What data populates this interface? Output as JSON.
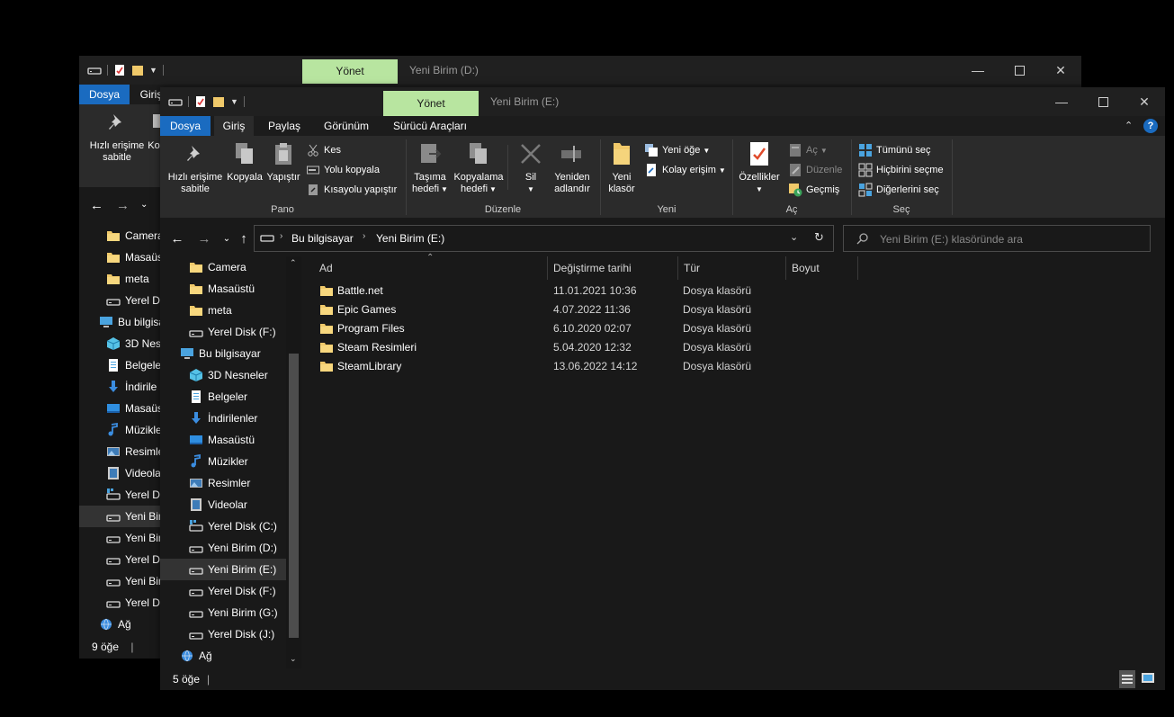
{
  "back_window": {
    "manage_tab": "Yönet",
    "title": "Yeni Birim (D:)",
    "tab_file": "Dosya",
    "tab_home": "Giriş",
    "pin_label": "Hızlı erişime sabitle",
    "copy_short": "Ko",
    "nav_items": [
      {
        "label": "Camera",
        "icon": "folder-icon"
      },
      {
        "label": "Masaüstü",
        "icon": "folder-icon"
      },
      {
        "label": "meta",
        "icon": "folder-icon"
      },
      {
        "label": "Yerel D",
        "icon": "drive-icon"
      },
      {
        "label": "Bu bilgisa",
        "icon": "pc-icon"
      },
      {
        "label": "3D Nesne",
        "icon": "cube-icon"
      },
      {
        "label": "Belgeler",
        "icon": "document-icon"
      },
      {
        "label": "İndirile",
        "icon": "download-icon"
      },
      {
        "label": "Masaüs",
        "icon": "desktop-icon"
      },
      {
        "label": "Müzikle",
        "icon": "music-icon"
      },
      {
        "label": "Resimle",
        "icon": "pictures-icon"
      },
      {
        "label": "Videola",
        "icon": "video-icon"
      },
      {
        "label": "Yerel D",
        "icon": "system-drive-icon"
      },
      {
        "label": "Yeni Bir",
        "icon": "drive-icon"
      },
      {
        "label": "Yeni Bir",
        "icon": "drive-icon"
      },
      {
        "label": "Yerel D",
        "icon": "drive-icon"
      },
      {
        "label": "Yeni Bir",
        "icon": "drive-icon"
      },
      {
        "label": "Yerel D",
        "icon": "drive-icon"
      },
      {
        "label": "Ağ",
        "icon": "network-icon"
      }
    ],
    "status": "9 öğe"
  },
  "window": {
    "manage_tab": "Yönet",
    "title": "Yeni Birim (E:)"
  },
  "tabs": [
    "Dosya",
    "Giriş",
    "Paylaş",
    "Görünüm",
    "Sürücü Araçları"
  ],
  "ribbon": {
    "pano": {
      "group": "Pano",
      "pin": "Hızlı erişime sabitle",
      "copy": "Kopyala",
      "paste": "Yapıştır",
      "cut": "Kes",
      "copy_path": "Yolu kopyala",
      "paste_shortcut": "Kısayolu yapıştır"
    },
    "duzenle": {
      "group": "Düzenle",
      "move_to_line1": "Taşıma",
      "move_to_line2": "hedefi",
      "copy_to_line1": "Kopyalama",
      "copy_to_line2": "hedefi",
      "delete": "Sil",
      "rename_line1": "Yeniden",
      "rename_line2": "adlandır"
    },
    "yeni": {
      "group": "Yeni",
      "new_folder_line1": "Yeni",
      "new_folder_line2": "klasör",
      "new_item": "Yeni öğe",
      "easy_access": "Kolay erişim"
    },
    "ac": {
      "group": "Aç",
      "properties": "Özellikler",
      "open": "Aç",
      "edit": "Düzenle",
      "history": "Geçmiş"
    },
    "sec": {
      "group": "Seç",
      "select_all": "Tümünü seç",
      "select_none": "Hiçbirini seçme",
      "invert": "Diğerlerini seç"
    }
  },
  "address": {
    "crumb1": "Bu bilgisayar",
    "crumb2": "Yeni Birim (E:)"
  },
  "search": {
    "placeholder": "Yeni Birim (E:) klasöründe ara"
  },
  "nav_items": [
    {
      "label": "Camera",
      "icon": "folder-icon"
    },
    {
      "label": "Masaüstü",
      "icon": "folder-icon"
    },
    {
      "label": "meta",
      "icon": "folder-icon"
    },
    {
      "label": "Yerel Disk (F:)",
      "icon": "drive-icon"
    },
    {
      "label": "Bu bilgisayar",
      "icon": "pc-icon"
    },
    {
      "label": "3D Nesneler",
      "icon": "cube-icon"
    },
    {
      "label": "Belgeler",
      "icon": "document-icon"
    },
    {
      "label": "İndirilenler",
      "icon": "download-icon"
    },
    {
      "label": "Masaüstü",
      "icon": "desktop-icon"
    },
    {
      "label": "Müzikler",
      "icon": "music-icon"
    },
    {
      "label": "Resimler",
      "icon": "pictures-icon"
    },
    {
      "label": "Videolar",
      "icon": "video-icon"
    },
    {
      "label": "Yerel Disk (C:)",
      "icon": "system-drive-icon"
    },
    {
      "label": "Yeni Birim (D:)",
      "icon": "drive-icon"
    },
    {
      "label": "Yeni Birim (E:)",
      "icon": "drive-icon"
    },
    {
      "label": "Yerel Disk (F:)",
      "icon": "drive-icon"
    },
    {
      "label": "Yeni Birim (G:)",
      "icon": "drive-icon"
    },
    {
      "label": "Yerel Disk (J:)",
      "icon": "drive-icon"
    },
    {
      "label": "Ağ",
      "icon": "network-icon"
    }
  ],
  "columns": [
    "Ad",
    "Değiştirme tarihi",
    "Tür",
    "Boyut"
  ],
  "files": [
    {
      "name": "Battle.net",
      "date": "11.01.2021 10:36",
      "type": "Dosya klasörü",
      "size": ""
    },
    {
      "name": "Epic Games",
      "date": "4.07.2022 11:36",
      "type": "Dosya klasörü",
      "size": ""
    },
    {
      "name": "Program Files",
      "date": "6.10.2020 02:07",
      "type": "Dosya klasörü",
      "size": ""
    },
    {
      "name": "Steam Resimleri",
      "date": "5.04.2020 12:32",
      "type": "Dosya klasörü",
      "size": ""
    },
    {
      "name": "SteamLibrary",
      "date": "13.06.2022 14:12",
      "type": "Dosya klasörü",
      "size": ""
    }
  ],
  "status": "5 öğe",
  "colors": {
    "accent": "#1a6bc0",
    "manage": "#b8e5a0",
    "folder": "#f0c96a"
  }
}
